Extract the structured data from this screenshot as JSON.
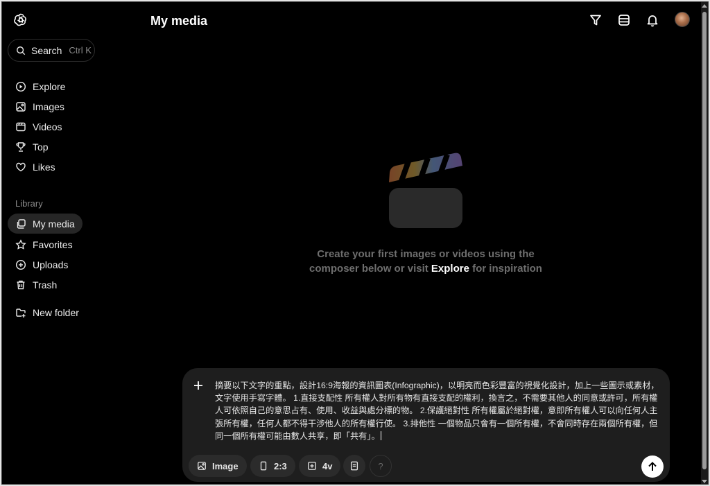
{
  "header": {
    "title": "My media"
  },
  "search": {
    "label": "Search",
    "shortcut": "Ctrl K"
  },
  "nav": {
    "items": [
      {
        "label": "Explore",
        "icon": "compass-icon"
      },
      {
        "label": "Images",
        "icon": "image-icon"
      },
      {
        "label": "Videos",
        "icon": "video-icon"
      },
      {
        "label": "Top",
        "icon": "trophy-icon"
      },
      {
        "label": "Likes",
        "icon": "heart-icon"
      }
    ],
    "library_label": "Library",
    "library": [
      {
        "label": "My media",
        "icon": "media-icon",
        "active": true
      },
      {
        "label": "Favorites",
        "icon": "star-icon"
      },
      {
        "label": "Uploads",
        "icon": "upload-icon"
      },
      {
        "label": "Trash",
        "icon": "trash-icon"
      }
    ],
    "new_folder": "New folder"
  },
  "empty_state": {
    "line1": "Create your first images or videos using the",
    "line2_prefix": "composer below or visit ",
    "link": "Explore",
    "line2_suffix": " for inspiration"
  },
  "composer": {
    "prompt": "摘要以下文字的重點，設計16:9海報的資訊圖表(Infographic)，以明亮而色彩豐富的視覺化設計，加上一些圖示或素材，文字使用手寫字體。 1.直接支配性 所有權人對所有物有直接支配的權利，換言之，不需要其他人的同意或許可，所有權人可依照自己的意思占有、使用、收益與處分標的物。 2.保護絕對性 所有權屬於絕對權，意即所有權人可以向任何人主張所有權，任何人都不得干涉他人的所有權行使。 3.排他性 一個物品只會有一個所有權，不會同時存在兩個所有權，但同一個所有權可能由數人共享，即「共有」。",
    "type_label": "Image",
    "aspect_label": "2:3",
    "variants_label": "4v",
    "help_label": "?"
  },
  "colors": {
    "background": "#000000",
    "sidebar_active": "#262626",
    "composer_bg": "#1e1e1e"
  }
}
